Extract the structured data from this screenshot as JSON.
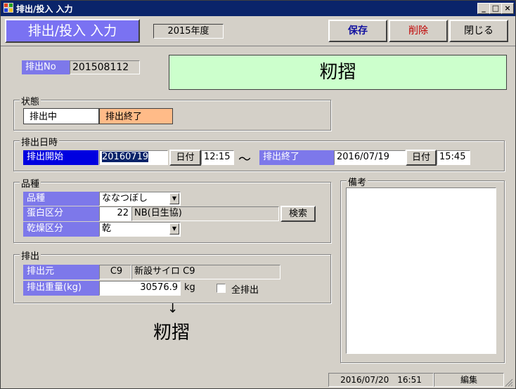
{
  "window": {
    "title": "排出/投入 入力"
  },
  "header": {
    "mode_label": "排出/投入 入力",
    "year_label": "2015年度",
    "save_label": "保存",
    "delete_label": "削除",
    "close_label": "閉じる"
  },
  "colors": {
    "accent": "#7d78ea",
    "banner": "#ccffcc",
    "end_state": "#ffbb88",
    "delete_text": "#c00000",
    "save_text": "#1010a0"
  },
  "discharge_no": {
    "label": "排出No",
    "value": "201508112"
  },
  "banner": {
    "text": "籾摺"
  },
  "state": {
    "title": "状態",
    "current": "排出中",
    "end": "排出終了"
  },
  "datetime": {
    "title": "排出日時",
    "start_label": "排出開始",
    "start_date": "20160719",
    "date_button": "日付",
    "start_time": "12:15",
    "tilde": "～",
    "end_label": "排出終了",
    "end_date": "2016/07/19",
    "end_time": "15:45"
  },
  "variety": {
    "title": "品種",
    "variety_label": "品種",
    "variety_value": "ななつぼし",
    "protein_label": "蛋白区分",
    "protein_code": "22",
    "protein_name": "NB(日生協)",
    "search_label": "検索",
    "dry_label": "乾燥区分",
    "dry_value": "乾"
  },
  "discharge": {
    "title": "排出",
    "source_label": "排出元",
    "source_code": "C9",
    "source_name": "新設サイロ C9",
    "weight_label": "排出重量(kg)",
    "weight_value": "30576.9",
    "unit": "kg",
    "all_label": "全排出"
  },
  "arrow": "↓",
  "destination": "籾摺",
  "remarks": {
    "title": "備考",
    "text": ""
  },
  "status": {
    "datetime": "2016/07/20　16:51",
    "mode": "編集"
  }
}
